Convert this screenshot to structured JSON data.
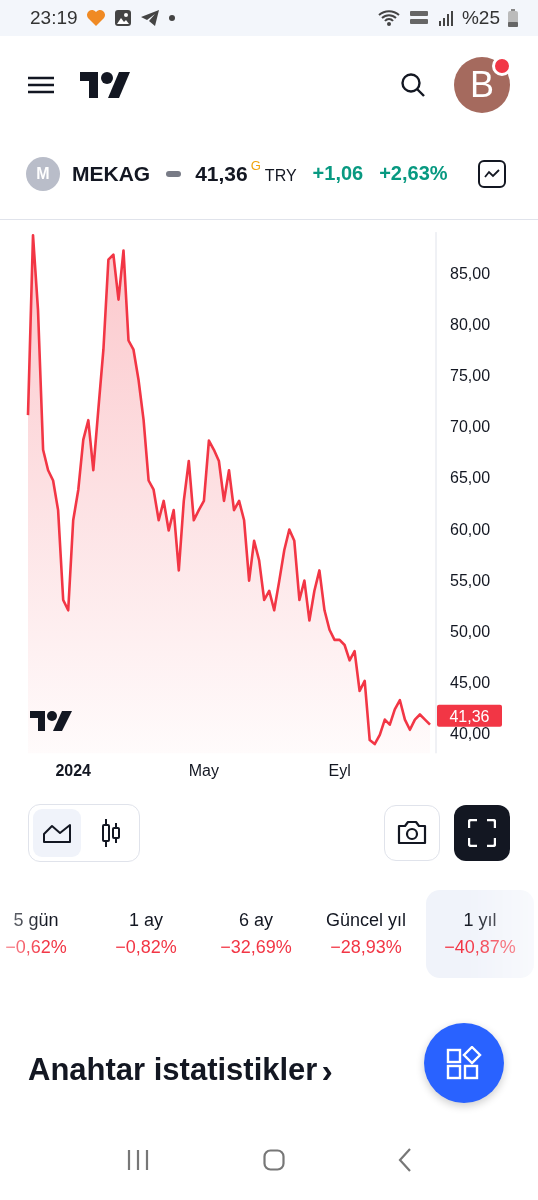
{
  "status_bar": {
    "time": "23:19",
    "battery": "%25"
  },
  "header": {
    "avatar_letter": "B",
    "notification_dot": true
  },
  "symbol": {
    "logo_letter": "M",
    "ticker": "MEKAG",
    "price": "41,36",
    "badge": "G",
    "currency": "TRY",
    "change": "+1,06",
    "change_percent": "+2,63%"
  },
  "chart": {
    "price_tag": "41,36",
    "chart_data": {
      "type": "area",
      "ylim": [
        38,
        89
      ],
      "categories": [
        null,
        null,
        null,
        null,
        null,
        null,
        null,
        null,
        null,
        "2024",
        null,
        null,
        null,
        null,
        null,
        null,
        null,
        null,
        null,
        null,
        null,
        null,
        null,
        null,
        null,
        null,
        null,
        null,
        null,
        null,
        null,
        null,
        null,
        null,
        null,
        "May",
        null,
        null,
        null,
        null,
        null,
        null,
        null,
        null,
        null,
        null,
        null,
        null,
        null,
        null,
        null,
        null,
        null,
        null,
        null,
        null,
        null,
        null,
        null,
        null,
        null,
        null,
        "Eyl",
        null,
        null,
        null,
        null,
        null,
        null,
        null,
        null,
        null,
        null,
        null,
        null,
        null,
        null,
        null,
        null,
        null,
        null
      ],
      "yticks": [
        {
          "value": 40,
          "label": "40,00"
        },
        {
          "value": 45,
          "label": "45,00"
        },
        {
          "value": 50,
          "label": "50,00"
        },
        {
          "value": 55,
          "label": "55,00"
        },
        {
          "value": 60,
          "label": "60,00"
        },
        {
          "value": 65,
          "label": "65,00"
        },
        {
          "value": 70,
          "label": "70,00"
        },
        {
          "value": 75,
          "label": "75,00"
        },
        {
          "value": 80,
          "label": "80,00"
        },
        {
          "value": 85,
          "label": "85,00"
        }
      ],
      "series": [
        {
          "color": "#f23645",
          "values": [
            71.1,
            88.7,
            81.4,
            67.7,
            65.7,
            64.7,
            61.8,
            53.0,
            52.0,
            60.8,
            63.8,
            68.7,
            70.6,
            65.7,
            71.6,
            77.5,
            86.3,
            86.8,
            82.4,
            87.2,
            78.4,
            77.5,
            74.5,
            70.6,
            64.7,
            63.8,
            60.8,
            62.7,
            59.8,
            61.8,
            55.9,
            62.7,
            66.6,
            60.8,
            61.8,
            62.7,
            68.6,
            67.7,
            66.6,
            62.7,
            65.7,
            61.8,
            62.7,
            60.8,
            54.9,
            58.8,
            56.9,
            53.0,
            53.9,
            52.0,
            54.9,
            57.9,
            59.9,
            58.8,
            53.0,
            54.9,
            51.0,
            53.9,
            55.9,
            52.0,
            50.1,
            49.1,
            49.1,
            48.6,
            47.1,
            48.0,
            44.1,
            45.1,
            39.3,
            38.9,
            39.8,
            41.3,
            40.8,
            42.3,
            43.2,
            41.3,
            40.3,
            41.3,
            41.8,
            41.3,
            40.8
          ]
        }
      ]
    }
  },
  "chart_types": [
    {
      "kind": "line",
      "selected": true
    },
    {
      "kind": "candles",
      "selected": false
    }
  ],
  "periods": [
    {
      "label": "5 gün",
      "change": "−0,62%",
      "selected": false
    },
    {
      "label": "1 ay",
      "change": "−0,82%",
      "selected": false
    },
    {
      "label": "6 ay",
      "change": "−32,69%",
      "selected": false
    },
    {
      "label": "Güncel yıl",
      "change": "−28,93%",
      "selected": false
    },
    {
      "label": "1 yıl",
      "change": "−40,87%",
      "selected": true
    }
  ],
  "section_title": "Anahtar istatistikler",
  "section_arrow": "›"
}
